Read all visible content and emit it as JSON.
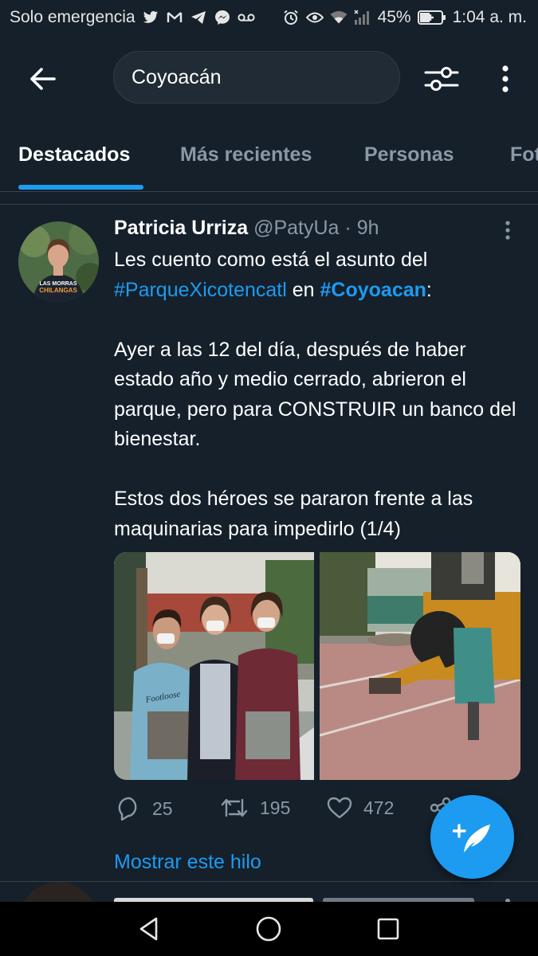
{
  "status_bar": {
    "carrier": "Solo emergencia",
    "battery": "45%",
    "time": "1:04 a. m.",
    "icons_left": [
      "twitter-icon",
      "gmail-icon",
      "telegram-icon",
      "messenger-icon",
      "voicemail-icon"
    ],
    "icons_right": [
      "alarm-icon",
      "eye-icon",
      "wifi-icon",
      "signal-icon",
      "battery-charging-icon"
    ]
  },
  "header": {
    "back_icon": "arrow-left-icon",
    "search_value": "Coyoacán",
    "filter_icon": "sliders-icon",
    "more_icon": "more-vertical-icon"
  },
  "tabs": [
    {
      "label": "Destacados",
      "active": true
    },
    {
      "label": "Más recientes",
      "active": false
    },
    {
      "label": "Personas",
      "active": false
    },
    {
      "label": "Fotos",
      "active": false
    }
  ],
  "tweet": {
    "author_name": "Patricia Urriza",
    "handle": "@PatyUa",
    "separator": " · ",
    "time": "9h",
    "text": {
      "p1_a": "Les cuento como está el asunto del ",
      "p1_tag1": "#ParqueXicotencatl",
      "p1_b": " en ",
      "p1_tag2": "#Coyoacan",
      "p1_c": ":",
      "p2": "Ayer a las 12 del día, después de haber estado año y medio cerrado, abrieron el parque, pero para CONSTRUIR un banco del bienestar.",
      "p3": "Estos dos héroes se pararon frente a las maquinarias para impedirlo (1/4)"
    },
    "avatar_shirt_text": "LAS MORRAS CHILANGAS",
    "photo_shirt_text": "Footloose",
    "replies": "25",
    "retweets": "195",
    "likes": "472",
    "show_thread": "Mostrar este hilo"
  },
  "colors": {
    "background": "#15202b",
    "accent": "#1d9bf0",
    "secondary_text": "#8b98a5",
    "divider": "#38444d"
  }
}
